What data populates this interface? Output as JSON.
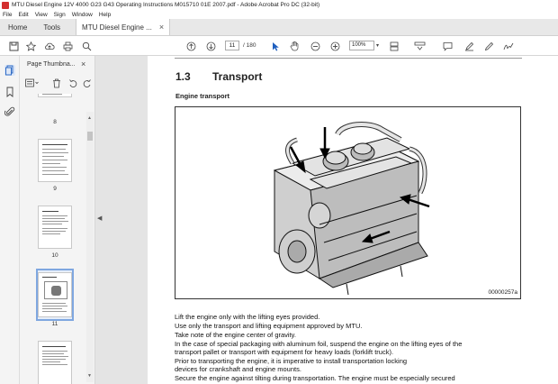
{
  "window": {
    "title": "MTU Diesel Engine 12V 4000 G23 G43 Operating Instructions M015710 01E 2007.pdf - Adobe Acrobat Pro DC (32-bit)"
  },
  "menu": [
    "File",
    "Edit",
    "View",
    "Sign",
    "Window",
    "Help"
  ],
  "tabs": {
    "home": "Home",
    "tools": "Tools",
    "document": "MTU Diesel Engine ...",
    "close": "×"
  },
  "toolbar": {
    "current_page": "11",
    "page_total": "/ 180",
    "zoom": "100%"
  },
  "thumbnails": {
    "header": "Page Thumbna...",
    "close": "×",
    "pages": [
      "8",
      "9",
      "10",
      "11"
    ],
    "selected": "11"
  },
  "document": {
    "section_number": "1.3",
    "section_title": "Transport",
    "subheading": "Engine transport",
    "figure_code": "00000257a",
    "paragraphs": [
      "Lift the engine only with the lifting eyes provided.",
      "Use only the transport and lifting equipment approved by MTU.",
      "Take note of the engine center of gravity.",
      "In the case of special packaging with aluminum foil, suspend the engine on the lifting eyes of the",
      "transport pallet or transport with equipment for heavy loads (forklift truck).",
      "Prior to transporting the engine, it is imperative to install transportation locking",
      "devices for crankshaft and engine mounts.",
      "Secure the engine against tilting during transportation.  The engine must be especially secured"
    ]
  }
}
